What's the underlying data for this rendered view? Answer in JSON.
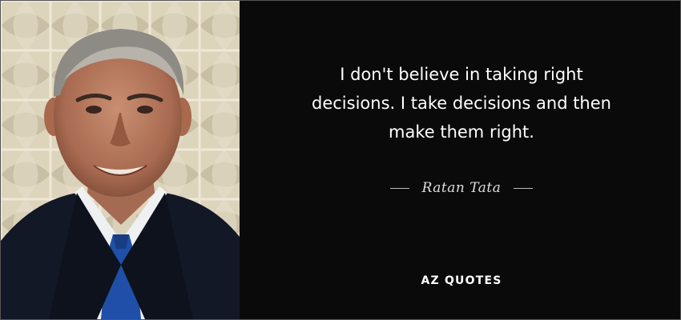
{
  "quote": {
    "lines": [
      "I don't believe in taking right",
      "decisions. I take decisions and then",
      "make them right."
    ]
  },
  "author": {
    "name": "Ratan Tata"
  },
  "logo": {
    "text": "AZ QUOTES"
  },
  "colors": {
    "panel_background": "#0a0a0a",
    "quote_text": "#ffffff",
    "author_text": "#dedede",
    "photo_wall": "#ded6bf",
    "suit": "#121826",
    "tie": "#1f4fa8"
  }
}
